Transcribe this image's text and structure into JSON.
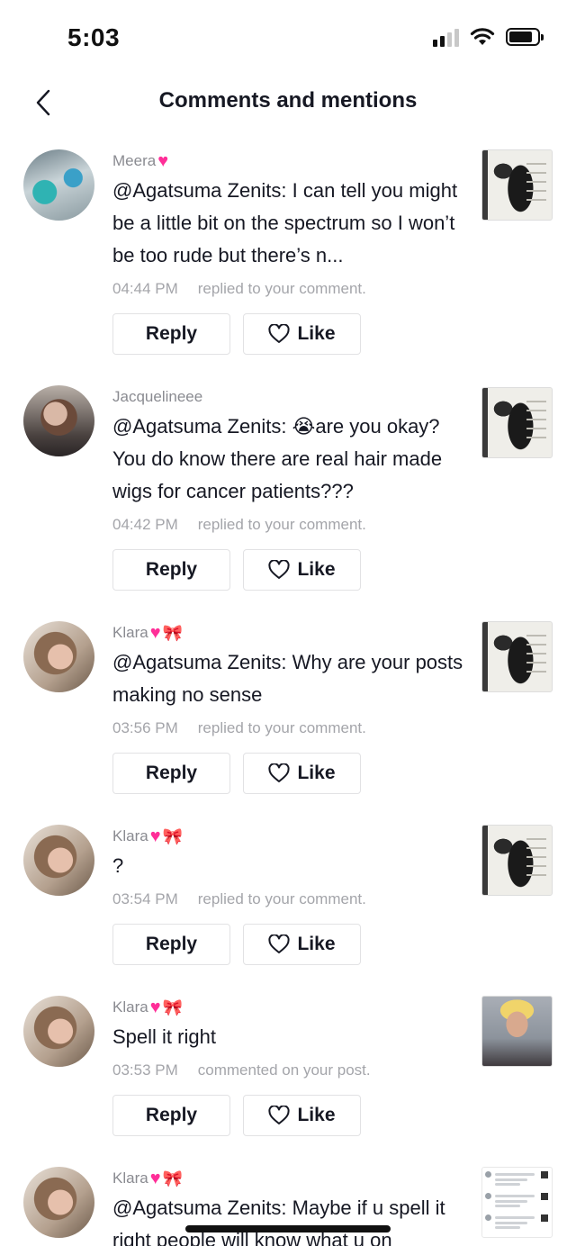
{
  "status_bar": {
    "time": "5:03"
  },
  "header": {
    "title": "Comments and mentions"
  },
  "buttons": {
    "reply": "Reply",
    "like": "Like"
  },
  "items": [
    {
      "username": "Meera",
      "emojis": [
        "heart"
      ],
      "text": "@Agatsuma Zenits: I can tell you might be a little bit on the spectrum so I won’t be too rude but there’s n...",
      "time": "04:44 PM",
      "action": "replied to your comment.",
      "thumbnail": "hair-photo"
    },
    {
      "username": "Jacquelineee",
      "emojis": [],
      "text": "@Agatsuma Zenits: 😭are you okay? You do know there are real hair made wigs for cancer patients???",
      "time": "04:42 PM",
      "action": "replied to your comment.",
      "thumbnail": "hair-photo"
    },
    {
      "username": "Klara",
      "emojis": [
        "heart",
        "bow"
      ],
      "text": "@Agatsuma Zenits: Why are your posts making no sense",
      "time": "03:56 PM",
      "action": "replied to your comment.",
      "thumbnail": "hair-photo"
    },
    {
      "username": "Klara",
      "emojis": [
        "heart",
        "bow"
      ],
      "text": "?",
      "time": "03:54 PM",
      "action": "replied to your comment.",
      "thumbnail": "hair-photo"
    },
    {
      "username": "Klara",
      "emojis": [
        "heart",
        "bow"
      ],
      "text": "Spell it right",
      "time": "03:53 PM",
      "action": "commented on your post.",
      "thumbnail": "person-photo"
    },
    {
      "username": "Klara",
      "emojis": [
        "heart",
        "bow"
      ],
      "text": "@Agatsuma Zenits: Maybe if u spell it right people will know what u on",
      "time": "",
      "action": "",
      "thumbnail": "screenshot-doc"
    }
  ]
}
